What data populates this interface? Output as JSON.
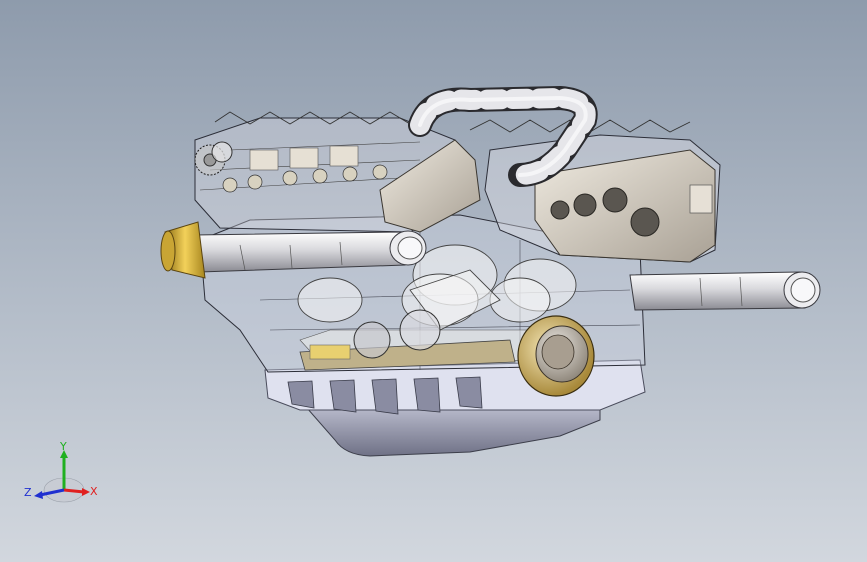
{
  "viewport": {
    "background_top": "#8e9bac",
    "background_bottom": "#d2d7de"
  },
  "model": {
    "subject": "v8-engine-assembly",
    "display_style": "shaded-with-transparent-parts"
  },
  "triad": {
    "x_label": "X",
    "y_label": "Y",
    "z_label": "Z",
    "x_color": "#e02020",
    "y_color": "#20b020",
    "z_color": "#2030d0"
  }
}
